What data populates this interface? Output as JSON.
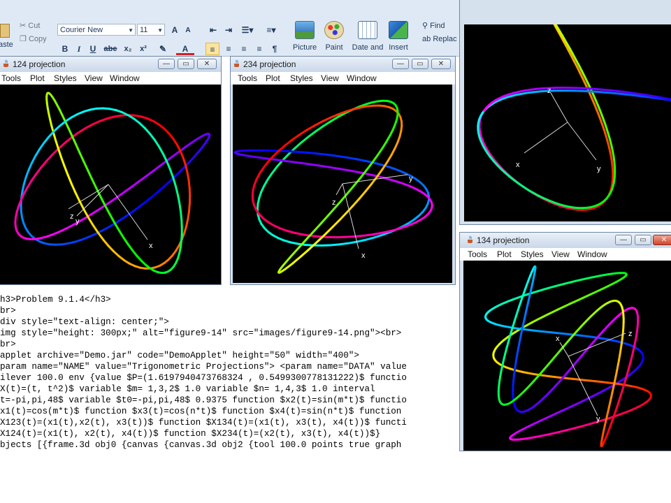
{
  "ribbon": {
    "cut_label": "Cut",
    "copy_label": "Copy",
    "paste_label": "aste",
    "font_name": "Courier New",
    "font_size": "11",
    "bold_label": "B",
    "italic_label": "I",
    "underline_label": "U",
    "strike_label": "abe",
    "subscript_label": "x₂",
    "superscript_label": "x²",
    "grow_font_label": "A",
    "shrink_font_label": "A",
    "picture_label": "Picture",
    "paint_label": "Paint",
    "date_label": "Date and",
    "insert_label": "Insert",
    "find_label": "Find",
    "replace_label": "Replac"
  },
  "menu_items": [
    "Tools",
    "Plot",
    "Styles",
    "View",
    "Window"
  ],
  "windows": {
    "w124": {
      "title": "124 projection"
    },
    "w234": {
      "title": "234 projection"
    },
    "w134": {
      "title": "134 projection"
    }
  },
  "axis_labels": {
    "w124": {
      "x": "x",
      "y": "y",
      "z": "z"
    },
    "w234": {
      "x": "x",
      "y": "y",
      "z": "z"
    },
    "wtop": {
      "x": "x",
      "y": "y",
      "z": "z"
    },
    "w134": {
      "x": "x",
      "y": "y",
      "z": "z"
    }
  },
  "window_buttons": {
    "minimize": "—",
    "maximize": "▭",
    "close": "✕"
  },
  "code_lines": [
    "h3>Problem 9.1.4</h3>",
    "br>",
    "div style=\"text-align: center;\">",
    "img style=\"height: 300px;\" alt=\"figure9-14\" src=\"images/figure9-14.png\"><br>",
    "br>",
    "applet archive=\"Demo.jar\" code=\"DemoApplet\" height=\"50\" width=\"400\">",
    "param name=\"NAME\" value=\"Trigonometric Projections\"> <param name=\"DATA\" value",
    "ilever 100.0 env {value $P=(1.6197940473768324 , 0.5499300778131222)$ functio",
    "X(t)=(t, t^2)$ variable $m= 1,3,2$ 1.0 variable $n= 1,4,3$ 1.0 interval",
    "t=-pi,pi,48$ variable $t0=-pi,pi,48$ 0.9375 function $x2(t)=sin(m*t)$ functio",
    "x1(t)=cos(m*t)$ function $x3(t)=cos(n*t)$ function $x4(t)=sin(n*t)$ function",
    "X123(t)=(x1(t),x2(t), x3(t))$ function $X134(t)=(x1(t), x3(t), x4(t))$ functi",
    "X124(t)=(x1(t), x2(t), x4(t))$ function $X234(t)=(x2(t), x3(t), x4(t))$}",
    "bjects [{frame.3d obj0 {canvas {canvas.3d obj2 {tool 100.0 points true graph"
  ]
}
